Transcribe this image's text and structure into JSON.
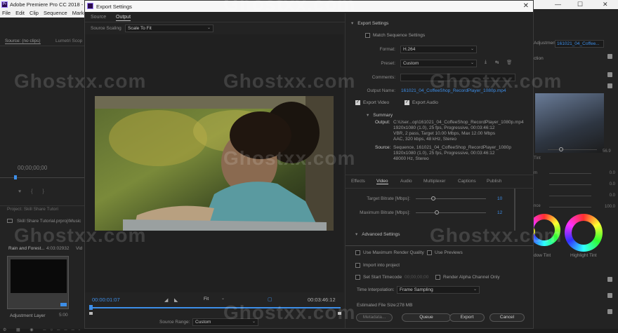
{
  "premiere": {
    "title": "Adobe Premiere Pro CC 2018 - C:\\U",
    "menu": [
      "File",
      "Edit",
      "Clip",
      "Sequence",
      "Markers"
    ],
    "left_tabs": [
      "Source: (no clips)",
      "Lumetri Scop"
    ],
    "timecode": "00;00;00;00",
    "project_tabs": [
      "Project: Skill Share Tutori"
    ],
    "project_name": "Skill Share Tutorial.prproj\\Music",
    "clip_name": "Rain and Forest...",
    "clip_dur": "4:03:02932",
    "clip_vid": "Vid",
    "adj_layer": "Adjustment Layer",
    "adj_dur": "5:00",
    "right_tabs": [
      "Adjustment...",
      "161021_04_Coffee..."
    ],
    "right_labels": [
      "ction",
      "Tint",
      "m",
      "nce",
      "Tint"
    ],
    "wheel_labels": [
      "dow Tint",
      "Highlight Tint"
    ],
    "right_values": [
      "0.0",
      "0.0",
      "0.0",
      "0.0",
      "100.0",
      "56.9"
    ]
  },
  "dialog": {
    "title": "Export Settings",
    "close": "✕",
    "source_tabs": [
      "Source",
      "Output"
    ],
    "source_scaling_label": "Source Scaling",
    "source_scaling_value": "Scale To Fit",
    "current_time": "00:00:01:07",
    "fit_value": "Fit",
    "duration": "00:03:46:12",
    "source_range_label": "Source Range:",
    "source_range_value": "Custom"
  },
  "export_settings": {
    "header": "Export Settings",
    "match_sequence": "Match Sequence Settings",
    "format_label": "Format:",
    "format_value": "H.264",
    "preset_label": "Preset:",
    "preset_value": "Custom",
    "comments_label": "Comments:",
    "comments_value": "",
    "output_name_label": "Output Name:",
    "output_name_value": "161021_04_CoffeeShop_RecordPlayer_1080p.mp4",
    "export_video": "Export Video",
    "export_audio": "Export Audio",
    "summary_header": "Summary",
    "output_label": "Output:",
    "output_lines": [
      "C:\\User...op\\161021_04_CoffeeShop_RecordPlayer_1080p.mp4",
      "1920x1080 (1.0), 25 fps, Progressive, 00:03:46:12",
      "VBR, 2 pass, Target 10.00 Mbps, Max 12.00 Mbps",
      "AAC, 320 kbps, 48 kHz, Stereo"
    ],
    "source_label": "Source:",
    "source_lines": [
      "Sequence, 161021_04_CoffeeShop_RecordPlayer_1080p",
      "1920x1080 (1.0), 25 fps, Progressive, 00:03:46:12",
      "48000 Hz, Stereo"
    ]
  },
  "tabs": [
    "Effects",
    "Video",
    "Audio",
    "Multiplexer",
    "Captions",
    "Publish"
  ],
  "bitrate": {
    "target_label": "Target Bitrate [Mbps]:",
    "target_value": "10",
    "target_fraction": 0.25,
    "max_label": "Maximum Bitrate [Mbps]:",
    "max_value": "12",
    "max_fraction": 0.3
  },
  "advanced": {
    "header": "Advanced Settings",
    "max_render_quality": "Use Maximum Render Quality",
    "use_previews": "Use Previews",
    "import_into_project": "Import into project",
    "set_start_timecode": "Set Start Timecode",
    "start_timecode_value": "00;00;00;00",
    "render_alpha": "Render Alpha Channel Only",
    "time_interp_label": "Time Interpolation:",
    "time_interp_value": "Frame Sampling",
    "est_file_size_label": "Estimated File Size:",
    "est_file_size_value": "278 MB"
  },
  "buttons": {
    "metadata": "Metadata...",
    "queue": "Queue",
    "export": "Export",
    "cancel": "Cancel"
  },
  "watermark": "Ghostxx.com",
  "colors": {
    "accent_blue": "#3d8ee8",
    "bg": "#232323"
  }
}
